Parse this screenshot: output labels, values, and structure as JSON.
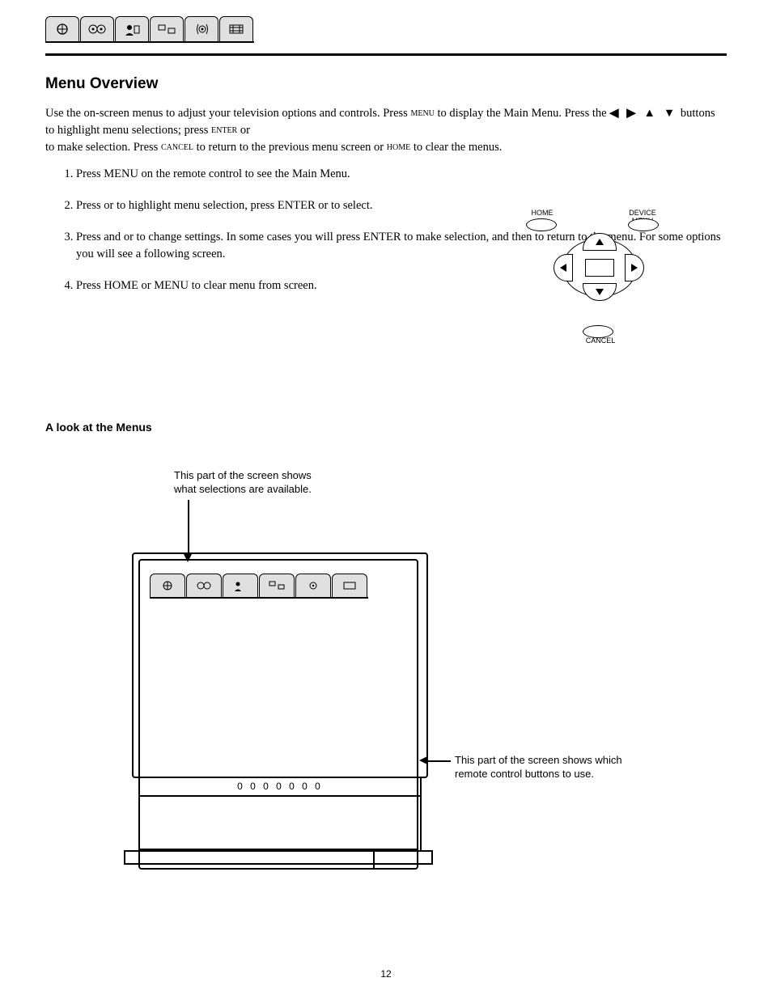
{
  "header": {
    "tabs": [
      "setup-tab",
      "timer-tab",
      "lock-tab",
      "picture-tab",
      "audio-tab",
      "video-tab"
    ]
  },
  "remote": {
    "home": "HOME",
    "device": "DEVICE",
    "menu": "MENU",
    "enter": "ENTER",
    "cancel": "CANCEL"
  },
  "text": {
    "h2": "Menu Overview",
    "p1_a": "Use the on-screen menus to adjust your television options and controls. Press ",
    "p1_b": " to display the Main Menu. Press the ",
    "arrows": "◀ ▶  ▲ ▼",
    "p1_c": " buttons to highlight menu selections; press ",
    "p1_d": " or",
    "p1_e": " to make selection. Press ",
    "p1_f": " to return to the previous menu screen or ",
    "p1_g": " to clear the menus.",
    "ol1": "Press MENU on the remote control to see the Main Menu.",
    "ol2_a": "Press ",
    "ol2_b": " or ",
    "ol2_c": " to highlight menu selection, press ENTER or   to select.",
    "ol3_a": "Press ",
    "ol3_b": " and ",
    "ol3_c": " or ",
    "ol3_d": " to change settings. In some cases you will press ENTER to make selection, and then ",
    "ol3_e": " to return to the menu. For some options you will see a following screen.",
    "ol4": "Press HOME or MENU to clear menu from screen.",
    "subhead": "A look at the Menus",
    "tvcap1_l1": "This part of the screen shows",
    "tvcap1_l2": "what selections are available.",
    "tvcap2_l1": "This part of the screen shows which",
    "tvcap2_l2": "remote control buttons to use.",
    "pagenum": "12"
  },
  "keys": {
    "menu": "MENU",
    "enter": "ENTER",
    "cancel": "CANCEL",
    "home": "HOME"
  }
}
